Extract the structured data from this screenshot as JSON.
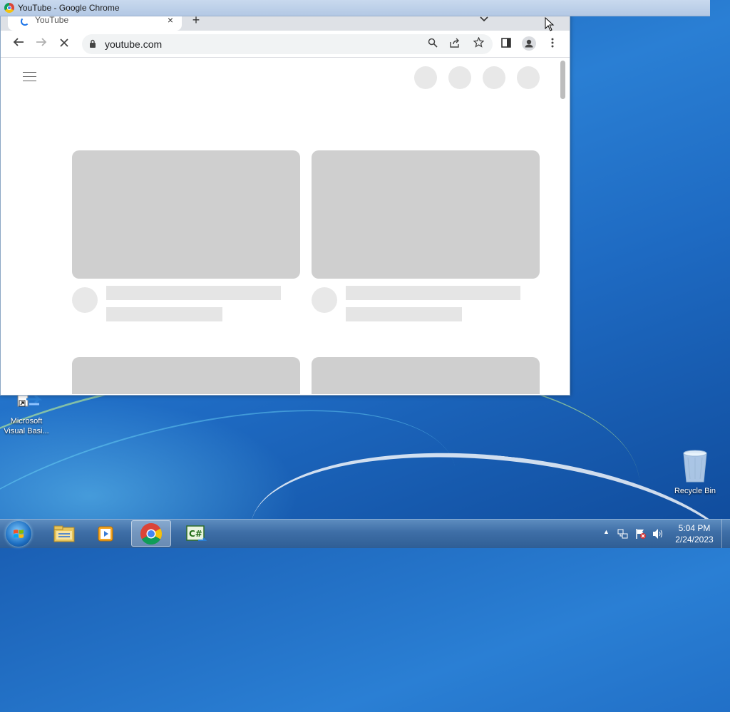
{
  "window": {
    "title": "YouTube - Google Chrome",
    "tab_title": "YouTube",
    "tab_close": "×",
    "new_tab": "+",
    "tab_search": "⌄"
  },
  "toolbar": {
    "back_icon": "←",
    "forward_icon": "→",
    "stop_icon": "✕",
    "url": "youtube.com",
    "search_icon": "⚲",
    "share_icon": "⇪",
    "bookmark_icon": "☆",
    "sidepanel_icon": "▣",
    "profile_icon": "person-icon",
    "menu_icon": "⋮"
  },
  "desktop": {
    "icons": [
      {
        "label": "Microsoft Visual Basi..."
      },
      {
        "label": "Recycle Bin"
      }
    ]
  },
  "taskbar": {
    "items": [
      {
        "name": "start-button"
      },
      {
        "name": "file-explorer"
      },
      {
        "name": "media-player"
      },
      {
        "name": "google-chrome",
        "active": true
      },
      {
        "name": "visual-csharp"
      }
    ],
    "tray": {
      "show_hidden": "▲"
    },
    "clock": {
      "time": "5:04 PM",
      "date": "2/24/2023"
    }
  },
  "colors": {
    "desktop_bg": "#1e6ac2",
    "taskbar": "#3e6ea6",
    "chrome_tabstrip": "#dee1e6",
    "skeleton_dark": "#cfcfcf",
    "skeleton_light": "#e8e8e8"
  }
}
